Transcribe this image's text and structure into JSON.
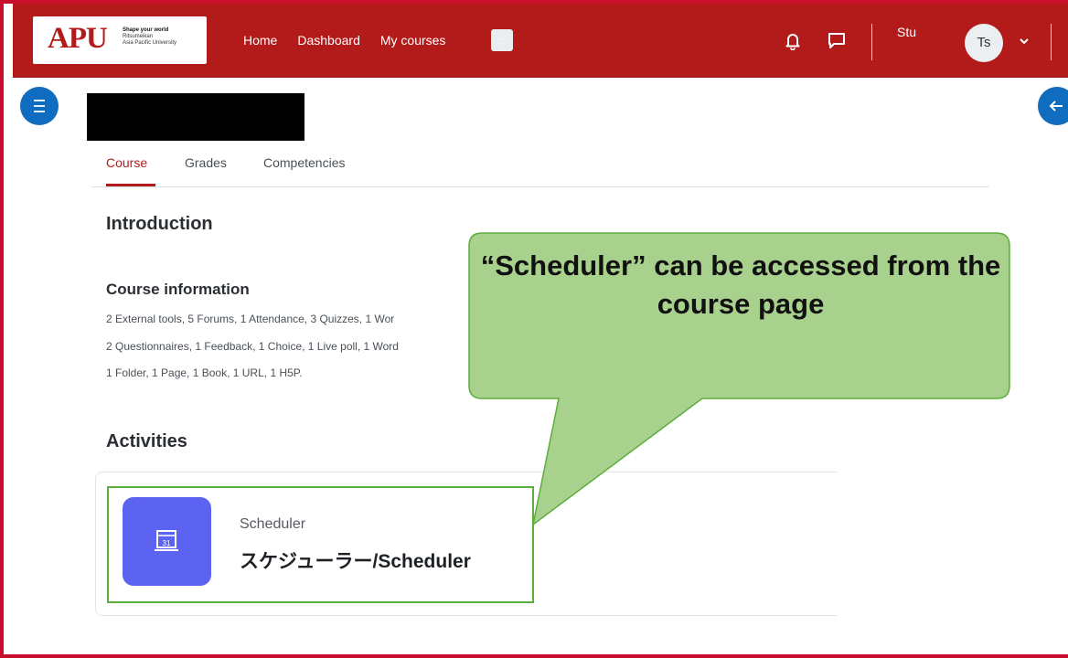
{
  "header": {
    "logo": {
      "brand": "APU",
      "tagline": "Shape your world",
      "sub1": "Ritsumeikan",
      "sub2": "Asia Pacific University"
    },
    "nav": [
      "Home",
      "Dashboard",
      "My courses"
    ],
    "more_label": "···",
    "user_short": "Stu",
    "avatar_initials": "Ts"
  },
  "tabs": [
    "Course",
    "Grades",
    "Competencies"
  ],
  "sections": {
    "introduction": "Introduction",
    "course_info_title": "Course information",
    "course_info_lines": [
      "2 External tools, 5 Forums, 1 Attendance, 3 Quizzes, 1 Wor",
      "2 Questionnaires, 1 Feedback, 1 Choice, 1 Live poll, 1 Word",
      "1 Folder, 1 Page, 1 Book, 1 URL, 1 H5P."
    ],
    "activities": "Activities"
  },
  "activity": {
    "type": "Scheduler",
    "name": "スケジューラー/Scheduler",
    "icon_text": "31"
  },
  "callout": {
    "text": "“Scheduler” can be accessed from the course page"
  },
  "colors": {
    "brand_red": "#b31b1b",
    "drawer_blue": "#0f6cbf",
    "activity_icon": "#5b63f0",
    "callout_fill": "#a9d18e",
    "callout_border": "#5cae3c"
  }
}
